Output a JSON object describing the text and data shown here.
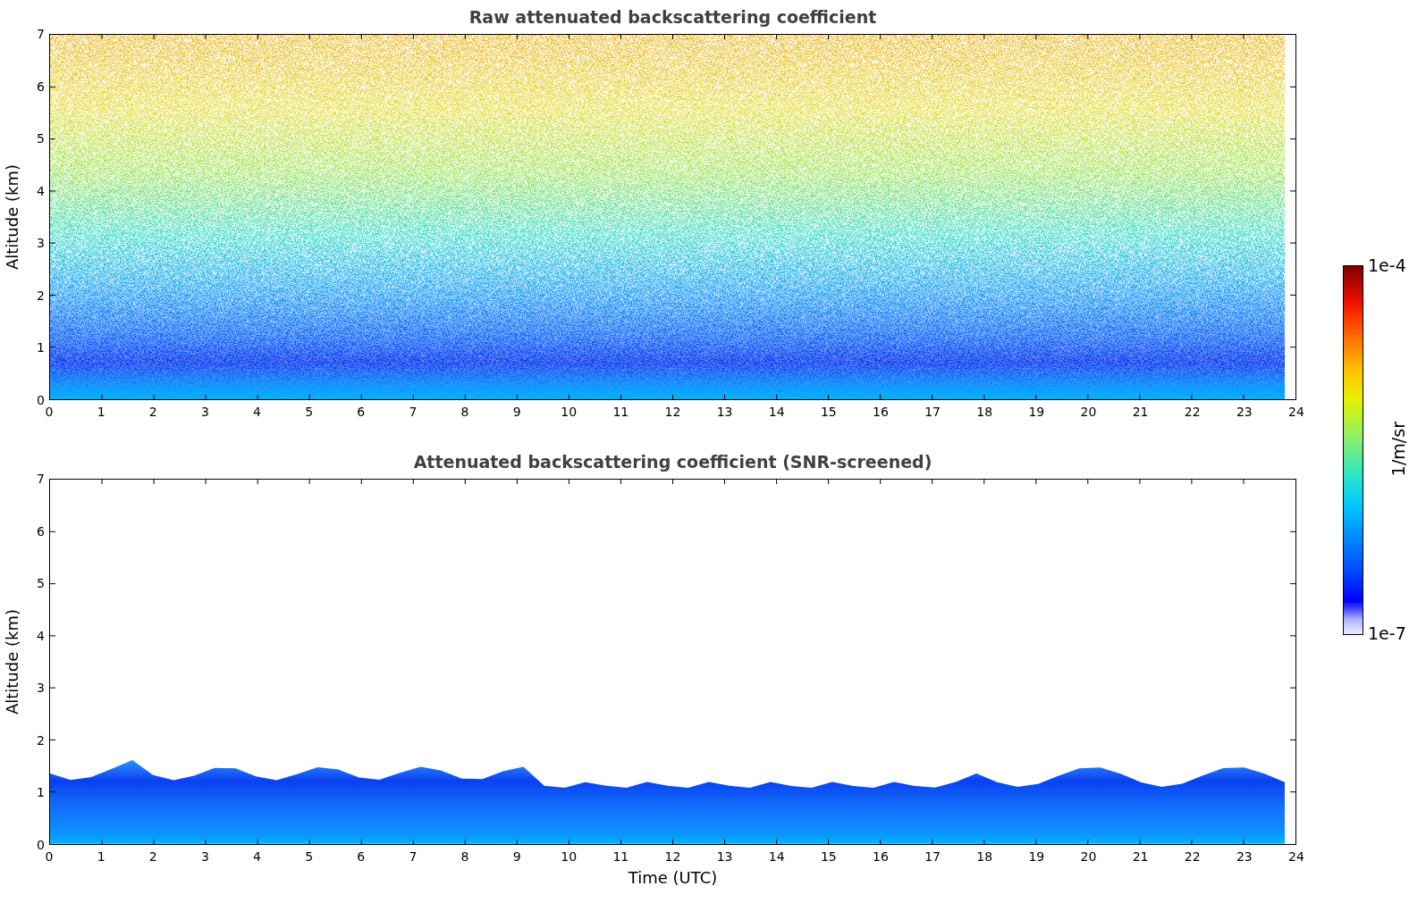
{
  "plots": [
    {
      "kind": "raw",
      "title": "Raw attenuated backscattering coefficient",
      "ylabel": "Altitude (km)",
      "yticks": [
        "7",
        "6",
        "5",
        "4",
        "3",
        "2",
        "1",
        "0"
      ],
      "xticks": [
        "0",
        "1",
        "2",
        "3",
        "4",
        "5",
        "6",
        "7",
        "8",
        "9",
        "10",
        "11",
        "12",
        "13",
        "14",
        "15",
        "16",
        "17",
        "18",
        "19",
        "20",
        "21",
        "22",
        "23",
        "24"
      ]
    },
    {
      "kind": "screened",
      "title": "Attenuated backscattering coefficient (SNR-screened)",
      "ylabel": "Altitude (km)",
      "yticks": [
        "7",
        "6",
        "5",
        "4",
        "3",
        "2",
        "1",
        "0"
      ],
      "xticks": [
        "0",
        "1",
        "2",
        "3",
        "4",
        "5",
        "6",
        "7",
        "8",
        "9",
        "10",
        "11",
        "12",
        "13",
        "14",
        "15",
        "16",
        "17",
        "18",
        "19",
        "20",
        "21",
        "22",
        "23",
        "24"
      ],
      "xlabel": "Time (UTC)"
    }
  ],
  "colorbar": {
    "max_label": "1e-4",
    "min_label": "1e-7",
    "label": "1/m/sr"
  }
}
